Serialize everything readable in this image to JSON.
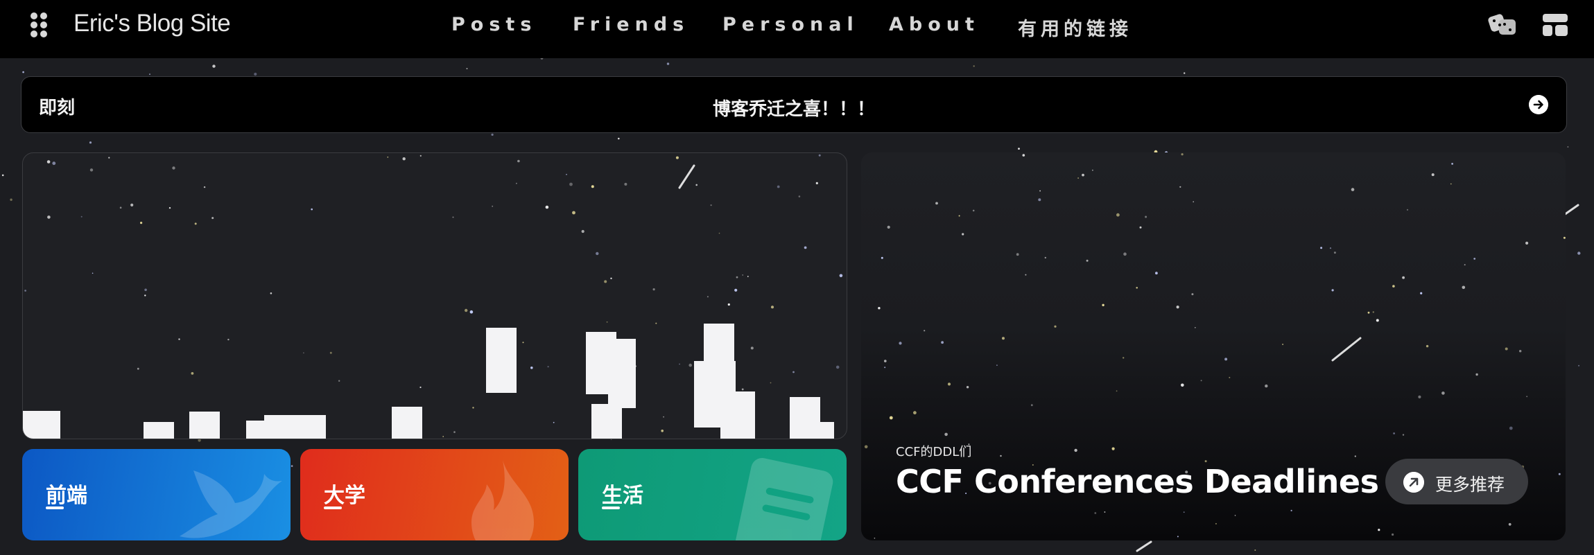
{
  "nav": {
    "site_title": "Eric's Blog Site",
    "links": [
      "Posts",
      "Friends",
      "Personal",
      "About",
      "有用的链接"
    ]
  },
  "announcement": {
    "tag": "即刻",
    "message": "博客乔迁之喜！！！"
  },
  "categories": [
    {
      "label": "前端",
      "color_from": "#0c58c4",
      "color_to": "#1a8fe3",
      "icon": "bird-icon"
    },
    {
      "label": "大学",
      "color_from": "#e02c1c",
      "color_to": "#e36016",
      "icon": "flame-icon"
    },
    {
      "label": "生活",
      "color_from": "#0e9a76",
      "color_to": "#13a486",
      "icon": "book-icon"
    }
  ],
  "feature": {
    "eyebrow": "CCF的DDL们",
    "title": "CCF Conferences Deadlines",
    "more_label": "更多推荐"
  },
  "colors": {
    "page_bg": "#1c1d21",
    "nav_bg": "#000000",
    "card_border": "#3b3c40"
  }
}
